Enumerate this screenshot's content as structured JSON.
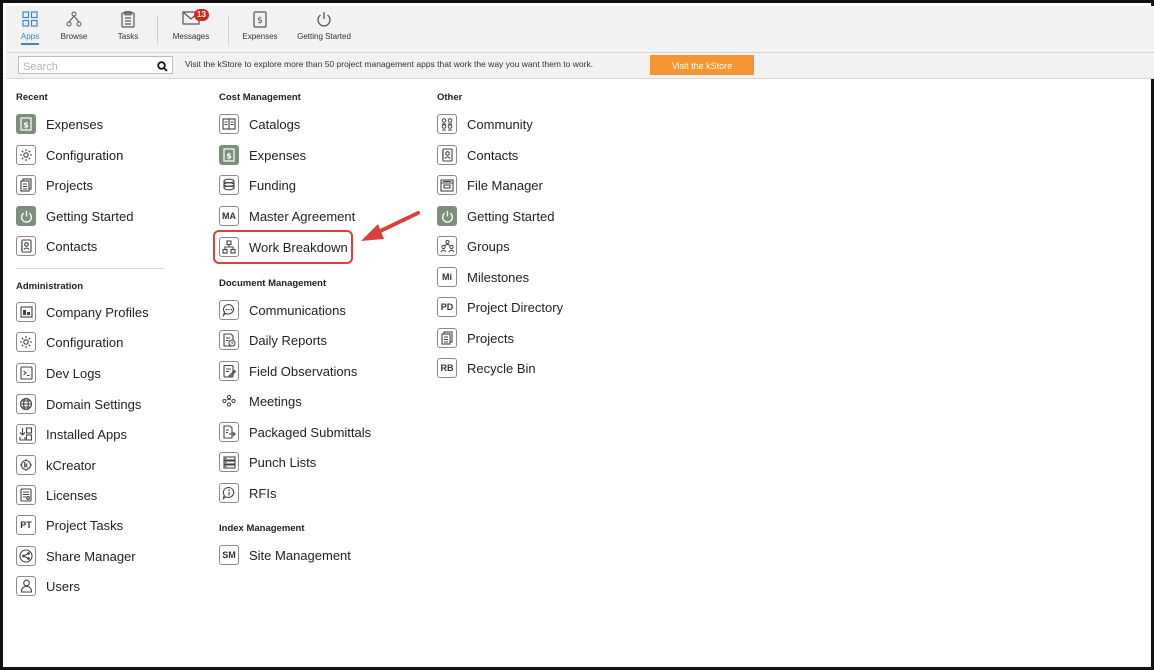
{
  "toolbar": {
    "items": [
      {
        "label": "Apps",
        "icon": "apps-grid-icon"
      },
      {
        "label": "Browse",
        "icon": "browse-tree-icon"
      },
      {
        "label": "Tasks",
        "icon": "clipboard-icon"
      },
      {
        "label": "Messages",
        "icon": "envelope-icon",
        "badge": "13"
      },
      {
        "label": "Expenses",
        "icon": "expenses-icon"
      },
      {
        "label": "Getting Started",
        "icon": "power-icon"
      }
    ]
  },
  "search": {
    "placeholder": "Search",
    "value": ""
  },
  "promo": {
    "text": "Visit the kStore to explore more than 50 project management apps that work the way you want them to work.",
    "button": "Visit the kStore"
  },
  "sections": {
    "recent": {
      "title": "Recent",
      "items": [
        {
          "label": "Expenses",
          "icon": "expenses-icon"
        },
        {
          "label": "Configuration",
          "icon": "gear-icon"
        },
        {
          "label": "Projects",
          "icon": "projects-icon"
        },
        {
          "label": "Getting Started",
          "icon": "power-icon"
        },
        {
          "label": "Contacts",
          "icon": "contacts-icon"
        }
      ]
    },
    "administration": {
      "title": "Administration",
      "items": [
        {
          "label": "Company Profiles",
          "icon": "company-icon"
        },
        {
          "label": "Configuration",
          "icon": "gear-icon"
        },
        {
          "label": "Dev Logs",
          "icon": "dev-logs-icon"
        },
        {
          "label": "Domain Settings",
          "icon": "globe-icon"
        },
        {
          "label": "Installed Apps",
          "icon": "installed-apps-icon"
        },
        {
          "label": "kCreator",
          "icon": "kcreator-icon"
        },
        {
          "label": "Licenses",
          "icon": "licenses-icon"
        },
        {
          "label": "Project Tasks",
          "icon": "text-badge-icon",
          "badge": "PT"
        },
        {
          "label": "Share Manager",
          "icon": "share-icon"
        },
        {
          "label": "Users",
          "icon": "user-icon"
        }
      ]
    },
    "cost_management": {
      "title": "Cost Management",
      "items": [
        {
          "label": "Catalogs",
          "icon": "catalog-icon"
        },
        {
          "label": "Expenses",
          "icon": "expenses-icon"
        },
        {
          "label": "Funding",
          "icon": "funding-icon"
        },
        {
          "label": "Master Agreement",
          "icon": "text-badge-icon",
          "badge": "MA"
        },
        {
          "label": "Work Breakdown",
          "icon": "hierarchy-icon"
        }
      ]
    },
    "document_management": {
      "title": "Document Management",
      "items": [
        {
          "label": "Communications",
          "icon": "chat-icon"
        },
        {
          "label": "Daily Reports",
          "icon": "daily-report-icon"
        },
        {
          "label": "Field Observations",
          "icon": "field-observation-icon"
        },
        {
          "label": "Meetings",
          "icon": "meeting-icon"
        },
        {
          "label": "Packaged Submittals",
          "icon": "submittal-icon"
        },
        {
          "label": "Punch Lists",
          "icon": "list-icon"
        },
        {
          "label": "RFIs",
          "icon": "info-bubble-icon"
        }
      ]
    },
    "index_management": {
      "title": "Index Management",
      "items": [
        {
          "label": "Site Management",
          "icon": "text-badge-icon",
          "badge": "SM"
        }
      ]
    },
    "other": {
      "title": "Other",
      "items": [
        {
          "label": "Community",
          "icon": "community-icon"
        },
        {
          "label": "Contacts",
          "icon": "contacts-icon"
        },
        {
          "label": "File Manager",
          "icon": "file-manager-icon"
        },
        {
          "label": "Getting Started",
          "icon": "power-icon"
        },
        {
          "label": "Groups",
          "icon": "groups-icon"
        },
        {
          "label": "Milestones",
          "icon": "text-badge-icon",
          "badge": "Mi"
        },
        {
          "label": "Project Directory",
          "icon": "text-badge-icon",
          "badge": "PD"
        },
        {
          "label": "Projects",
          "icon": "projects-icon"
        },
        {
          "label": "Recycle Bin",
          "icon": "text-badge-icon",
          "badge": "RB"
        }
      ]
    }
  },
  "colors": {
    "accent": "#3b88c4",
    "kstore_button": "#f49632",
    "highlight": "#d9423a",
    "filled_icon": "#7c8f7d",
    "badge": "#d9261c"
  }
}
